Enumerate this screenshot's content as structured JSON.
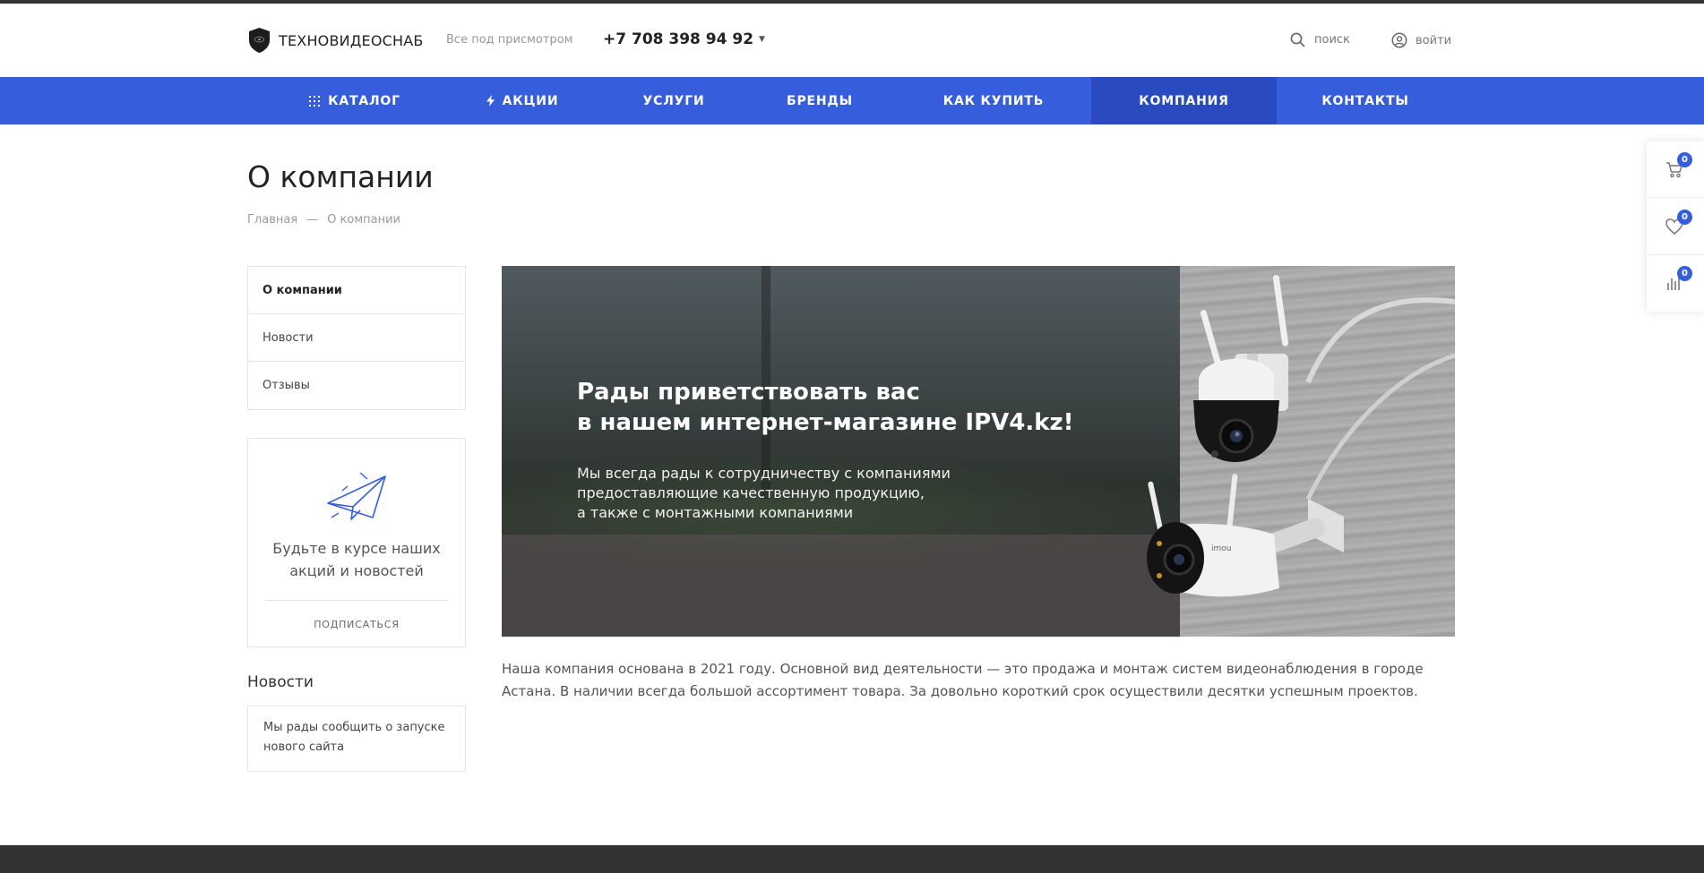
{
  "header": {
    "logo_text": "ТЕХНОВИДЕОСНАБ",
    "slogan": "Все под присмотром",
    "phone": "+7 708 398 94 92",
    "search_label": "поиск",
    "login_label": "войти"
  },
  "nav": {
    "items": [
      {
        "label": "Каталог"
      },
      {
        "label": "Акции"
      },
      {
        "label": "Услуги"
      },
      {
        "label": "Бренды"
      },
      {
        "label": "Как купить"
      },
      {
        "label": "Компания"
      },
      {
        "label": "Контакты"
      }
    ],
    "active": "Компания"
  },
  "page": {
    "title": "О компании",
    "breadcrumbs": [
      "Главная",
      "—",
      "О компании"
    ]
  },
  "side_menu": {
    "items": [
      {
        "label": "О компании"
      },
      {
        "label": "Новости"
      },
      {
        "label": "Отзывы"
      }
    ]
  },
  "subscribe": {
    "text_line1": "Будьте в курсе наших",
    "text_line2": "акций и новостей",
    "button": "Подписаться"
  },
  "news": {
    "heading": "Новости",
    "item_line1": "Мы рады сообщить о запуске",
    "item_line2": "нового сайта"
  },
  "banner": {
    "title_line1": "Рады приветствовать вас",
    "title_line2": "в нашем интернет-магазине IPV4.kz!",
    "text_line1": "Мы всегда рады к сотрудничеству с компаниями",
    "text_line2": "предоставляющие качественную продукцию,",
    "text_line3": "а также с монтажными компаниями",
    "camera_brand": "imou"
  },
  "about": {
    "text": "Наша компания основана в 2021 году. Основной вид деятельности — это продажа и монтаж систем видеонаблюдения в городе Астана. В наличии всегда большой ассортимент товара. За довольно короткий срок осуществили десятки успешным проектов."
  },
  "float_panel": {
    "cart_count": "0",
    "favorites_count": "0",
    "compare_count": "0"
  },
  "colors": {
    "accent": "#365edc",
    "accent_active": "#2a4bbf",
    "dark": "#333333"
  }
}
